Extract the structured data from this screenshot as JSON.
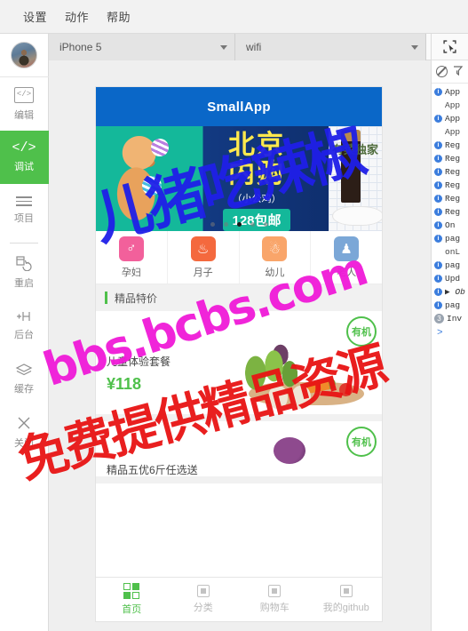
{
  "menubar": {
    "items": [
      {
        "label": "设置",
        "name": "menu-settings"
      },
      {
        "label": "动作",
        "name": "menu-actions"
      },
      {
        "label": "帮助",
        "name": "menu-help"
      }
    ]
  },
  "sidebar": {
    "items": [
      {
        "label": "编辑",
        "icon": "code-box-icon",
        "active": false
      },
      {
        "label": "调试",
        "icon": "code-slash-icon",
        "active": true
      },
      {
        "label": "项目",
        "icon": "hamburger-icon",
        "active": false
      },
      {
        "label": "重启",
        "icon": "restart-icon",
        "active": false
      },
      {
        "label": "后台",
        "icon": "backstage-icon",
        "active": false
      },
      {
        "label": "缓存",
        "icon": "layers-icon",
        "active": false
      },
      {
        "label": "关闭",
        "icon": "close-icon",
        "active": false
      }
    ]
  },
  "toolbar": {
    "device_select": "iPhone 5",
    "network_select": "wifi",
    "select_tool_icon": "cursor-select-icon"
  },
  "simulator": {
    "app_title": "SmallApp",
    "carousel": {
      "slide_title_line1": "北京",
      "slide_title_line2": "内购",
      "slide_subtitle": "（小公鸡）",
      "slide_price": "128包邮",
      "next_slide_label": "有菜独家",
      "dots": 5,
      "active_dot_index": 2
    },
    "categories": [
      {
        "label": "孕妇",
        "color": "#f2609b",
        "icon": "pregnant-icon"
      },
      {
        "label": "月子",
        "color": "#f4693e",
        "icon": "mother-baby-icon"
      },
      {
        "label": "幼儿",
        "color": "#f9a56a",
        "icon": "child-icon"
      },
      {
        "label": "老人",
        "color": "#7ba7d7",
        "icon": "elderly-icon"
      }
    ],
    "section_title": "精品特价",
    "products": [
      {
        "title": "儿童体验套餐",
        "price": "¥118",
        "badge": "有机"
      },
      {
        "title": "精品五优6斤任选送",
        "price": "",
        "badge": "有机"
      }
    ],
    "tabbar": [
      {
        "label": "首页",
        "icon": "home-grid-icon",
        "active": true
      },
      {
        "label": "分类",
        "icon": "chip-icon",
        "active": false
      },
      {
        "label": "购物车",
        "icon": "chip-icon",
        "active": false
      },
      {
        "label": "我的github",
        "icon": "chip-icon",
        "active": false
      }
    ]
  },
  "console": {
    "clear_icon": "clear-console-icon",
    "filter_icon": "filter-funnel-icon",
    "prompt": ">",
    "rows": [
      {
        "icon": "info",
        "text": "App"
      },
      {
        "icon": "none",
        "text": "App",
        "indent": true
      },
      {
        "icon": "info",
        "text": "App"
      },
      {
        "icon": "none",
        "text": "App",
        "indent": true
      },
      {
        "icon": "info",
        "text": "Reg"
      },
      {
        "icon": "info",
        "text": "Reg"
      },
      {
        "icon": "info",
        "text": "Reg"
      },
      {
        "icon": "info",
        "text": "Reg"
      },
      {
        "icon": "info",
        "text": "Reg"
      },
      {
        "icon": "info",
        "text": "Reg"
      },
      {
        "icon": "info",
        "text": "On"
      },
      {
        "icon": "info",
        "text": "pag"
      },
      {
        "icon": "none",
        "text": "onL",
        "indent": true
      },
      {
        "icon": "info",
        "text": "pag"
      },
      {
        "icon": "info",
        "text": "Upd"
      },
      {
        "icon": "info",
        "text": "▶ Ob",
        "italic": true
      },
      {
        "icon": "info",
        "text": "pag"
      },
      {
        "icon": "count",
        "count": "3",
        "text": "Inv"
      }
    ]
  },
  "watermarks": [
    {
      "text": "儿猪吃辣椒",
      "color": "#1f1fe8"
    },
    {
      "text": "bbs.bcbs.com",
      "color": "#f01ad8"
    },
    {
      "text": "免费提供精品资源",
      "color": "#e81414"
    }
  ],
  "colors": {
    "accent_green": "#4fc04b",
    "app_blue": "#0a67c8",
    "window_bg": "#efefef"
  }
}
